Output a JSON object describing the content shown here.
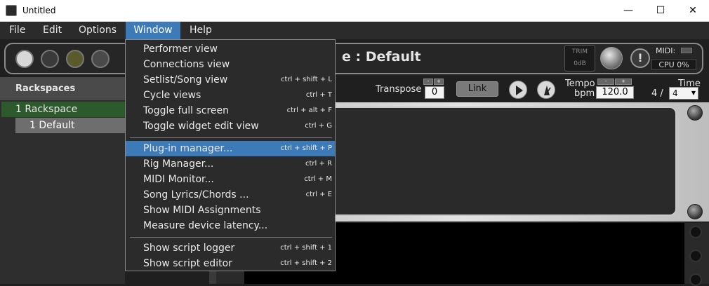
{
  "window": {
    "title": "Untitled",
    "min": "—",
    "max": "☐",
    "close": "✕"
  },
  "menubar": {
    "items": [
      "File",
      "Edit",
      "Options",
      "Window",
      "Help"
    ]
  },
  "header": {
    "rackspace_name_partial": "e : Default"
  },
  "trim": {
    "label": "TRIM",
    "value": "0dB"
  },
  "status": {
    "warn": "!",
    "midi_label": "MIDI:",
    "cpu": "CPU  0%"
  },
  "left_panel": {
    "header": "Rackspaces",
    "rackspace": "1  Rackspace",
    "variation": "1   Default"
  },
  "transport": {
    "transpose_label": "Transpose",
    "transpose_value": "0",
    "link_label": "Link",
    "tempo_label": "Tempo",
    "bpm_label": "bpm",
    "tempo_value": "120.0",
    "time_label": "Time",
    "time_numer": "4  /",
    "time_denom": "4",
    "minus": "-",
    "plus": "+"
  },
  "window_menu": {
    "items": [
      {
        "label": "Performer view",
        "shortcut": ""
      },
      {
        "label": "Connections view",
        "shortcut": ""
      },
      {
        "label": "Setlist/Song view",
        "shortcut": "ctrl + shift + L"
      },
      {
        "label": "Cycle views",
        "shortcut": "ctrl + T"
      },
      {
        "label": "Toggle full screen",
        "shortcut": "ctrl + alt + F"
      },
      {
        "label": "Toggle widget edit view",
        "shortcut": "ctrl + G"
      },
      {
        "label": "Plug-in manager...",
        "shortcut": "ctrl + shift + P"
      },
      {
        "label": "Rig Manager...",
        "shortcut": "ctrl + R"
      },
      {
        "label": "MIDI Monitor...",
        "shortcut": "ctrl + M"
      },
      {
        "label": "Song Lyrics/Chords ...",
        "shortcut": "ctrl + E"
      },
      {
        "label": "Show MIDI Assignments",
        "shortcut": ""
      },
      {
        "label": "Measure device latency...",
        "shortcut": ""
      },
      {
        "label": "Show script logger",
        "shortcut": "ctrl + shift + 1"
      },
      {
        "label": "Show script editor",
        "shortcut": "ctrl + shift + 2"
      }
    ],
    "highlighted_index": 6
  },
  "colors": {
    "accent": "#3d7bb8",
    "rackspace_selected": "#2d5a2d"
  }
}
